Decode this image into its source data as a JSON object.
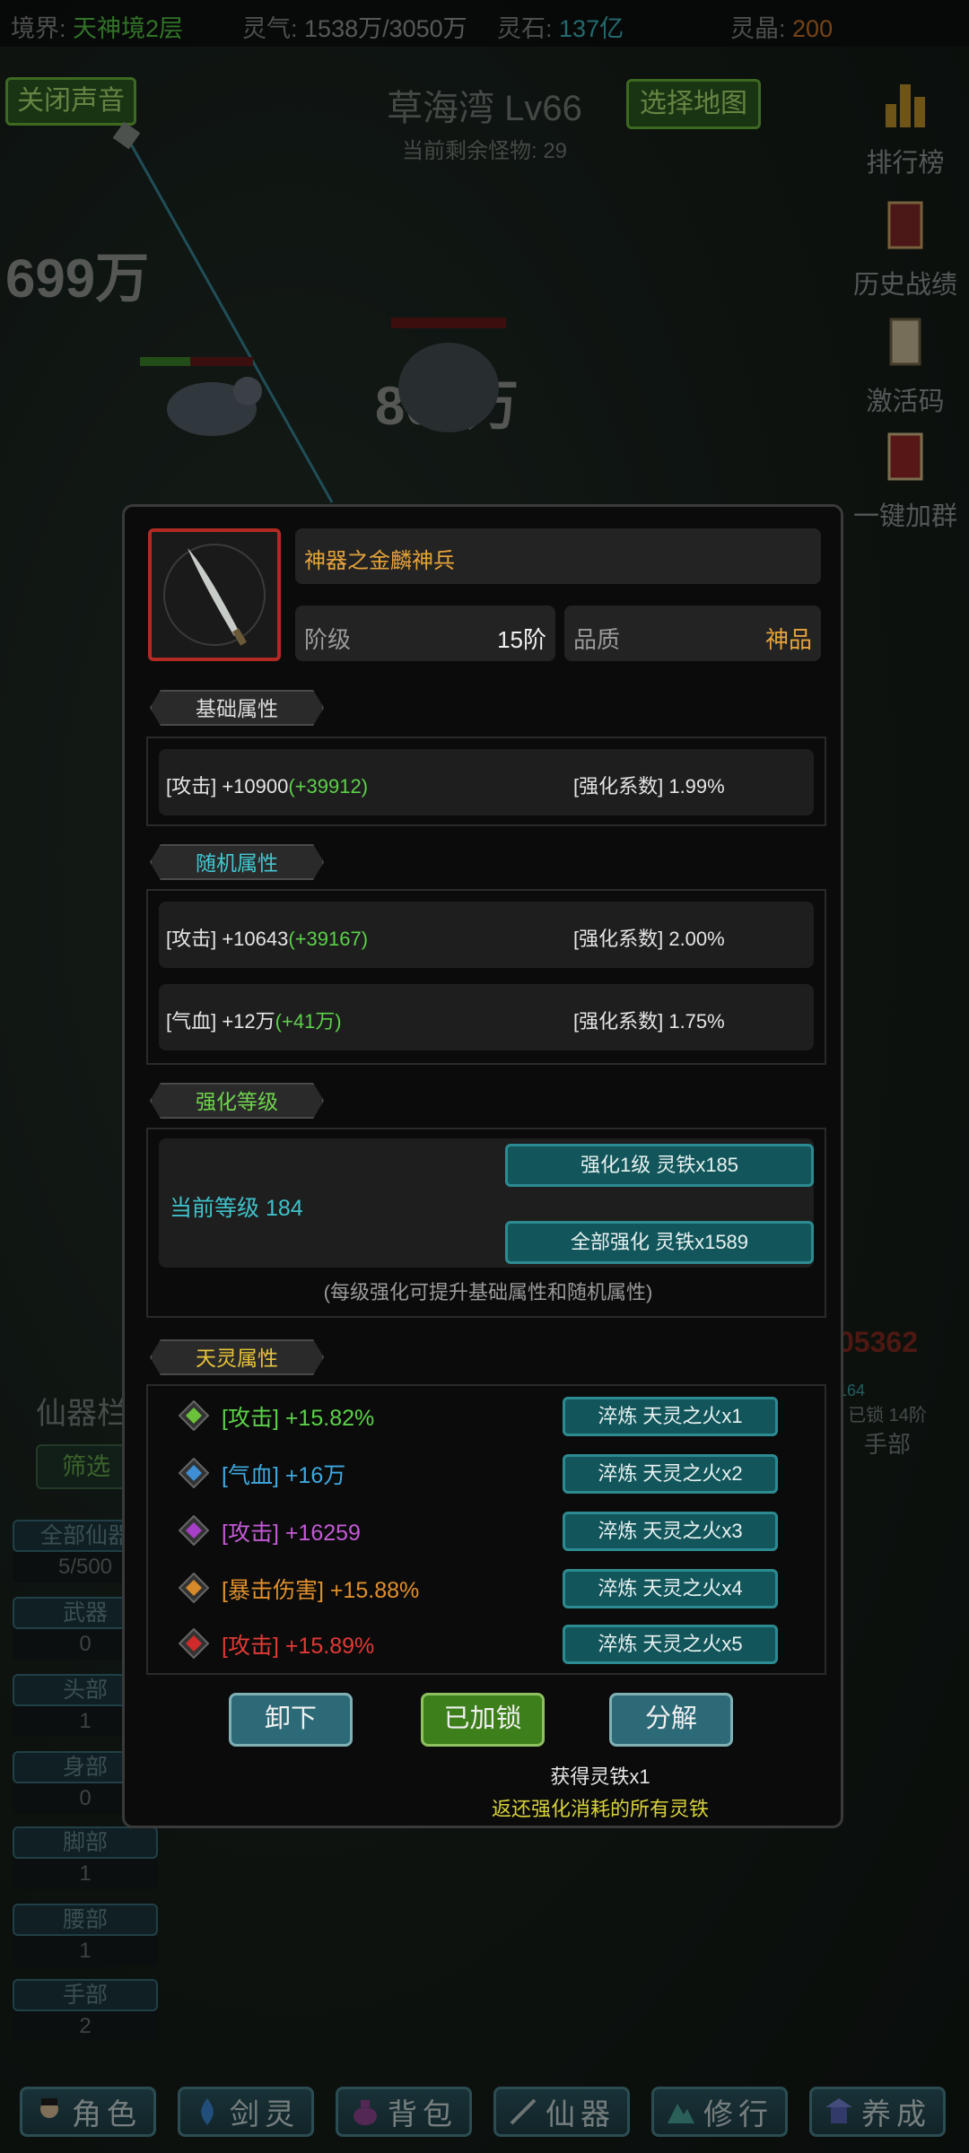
{
  "topbar": {
    "realm_label": "境界:",
    "realm_value": "天神境2层",
    "qi_label": "灵气:",
    "qi_value": "1538万/3050万",
    "stone_label": "灵石:",
    "stone_value": "137亿",
    "crystal_label": "灵晶:",
    "crystal_value": "200"
  },
  "battle": {
    "sound_button": "关闭声音",
    "map_title": "草海湾 Lv66",
    "monsters_left": "当前剩余怪物: 29",
    "select_map_button": "选择地图",
    "damage_numbers": [
      "699万",
      "807万"
    ]
  },
  "side_menu": [
    {
      "label": "排行榜",
      "icon": "bar-chart-icon"
    },
    {
      "label": "历史战绩",
      "icon": "book-icon"
    },
    {
      "label": "激活码",
      "icon": "scroll-icon"
    },
    {
      "label": "一键加群",
      "icon": "group-book-icon"
    }
  ],
  "left_panel": {
    "title": "仙器栏",
    "filter": "筛选",
    "categories": [
      {
        "label": "全部仙器",
        "count": "5/500"
      },
      {
        "label": "武器",
        "count": "0"
      },
      {
        "label": "头部",
        "count": "1"
      },
      {
        "label": "身部",
        "count": "0"
      },
      {
        "label": "脚部",
        "count": "1"
      },
      {
        "label": "腰部",
        "count": "1"
      },
      {
        "label": "手部",
        "count": "2"
      }
    ],
    "right_slot_level": "164",
    "right_slot_lock": "已锁",
    "right_slot_grade": "14阶",
    "right_slot_label": "手部",
    "red_number": "05362"
  },
  "bottom_nav": [
    {
      "label": "角色",
      "icon": "character-icon"
    },
    {
      "label": "剑灵",
      "icon": "flame-icon"
    },
    {
      "label": "背包",
      "icon": "bag-icon"
    },
    {
      "label": "仙器",
      "icon": "sword-icon"
    },
    {
      "label": "修行",
      "icon": "mountain-icon"
    },
    {
      "label": "养成",
      "icon": "pagoda-icon"
    }
  ],
  "item": {
    "name": "神器之金麟神兵",
    "grade_label": "阶级",
    "grade_value": "15阶",
    "quality_label": "品质",
    "quality_value": "神品",
    "icon": "curved-blade-icon"
  },
  "base_attrs": {
    "title": "基础属性",
    "rows": [
      {
        "stat": "[攻击] +10900",
        "bonus": "(+39912)",
        "coef": "[强化系数] 1.99%"
      }
    ]
  },
  "random_attrs": {
    "title": "随机属性",
    "rows": [
      {
        "stat": "[攻击] +10643",
        "bonus": "(+39167)",
        "coef": "[强化系数] 2.00%"
      },
      {
        "stat": "[气血] +12万",
        "bonus": "(+41万)",
        "coef": "[强化系数] 1.75%"
      }
    ]
  },
  "enhance": {
    "title": "强化等级",
    "current": "当前等级 184",
    "btn_one": "强化1级 灵铁x185",
    "btn_all": "全部强化 灵铁x1589",
    "note": "(每级强化可提升基础属性和随机属性)"
  },
  "tianling": {
    "title": "天灵属性",
    "rows": [
      {
        "text": "[攻击] +15.82%",
        "color": "#5cd14a",
        "gem": "#6bc23a",
        "btn": "淬炼 天灵之火x1"
      },
      {
        "text": "[气血] +16万",
        "color": "#3fa9e0",
        "gem": "#3f8fd6",
        "btn": "淬炼 天灵之火x2"
      },
      {
        "text": "[攻击] +16259",
        "color": "#c45ad6",
        "gem": "#a63fc8",
        "btn": "淬炼 天灵之火x3"
      },
      {
        "text": "[暴击伤害] +15.88%",
        "color": "#e0902c",
        "gem": "#d68a2a",
        "btn": "淬炼 天灵之火x4"
      },
      {
        "text": "[攻击] +15.89%",
        "color": "#e03a36",
        "gem": "#d02a2a",
        "btn": "淬炼 天灵之火x5"
      }
    ]
  },
  "actions": {
    "unequip": "卸下",
    "locked": "已加锁",
    "decompose": "分解",
    "reward_line1": "获得灵铁x1",
    "reward_line2": "返还强化消耗的所有灵铁"
  },
  "colors": {
    "accent_teal": "#2c8b91",
    "quality_orange": "#e6a33a",
    "item_name": "#e6a33a",
    "hint_yellow": "#d8d23a"
  }
}
